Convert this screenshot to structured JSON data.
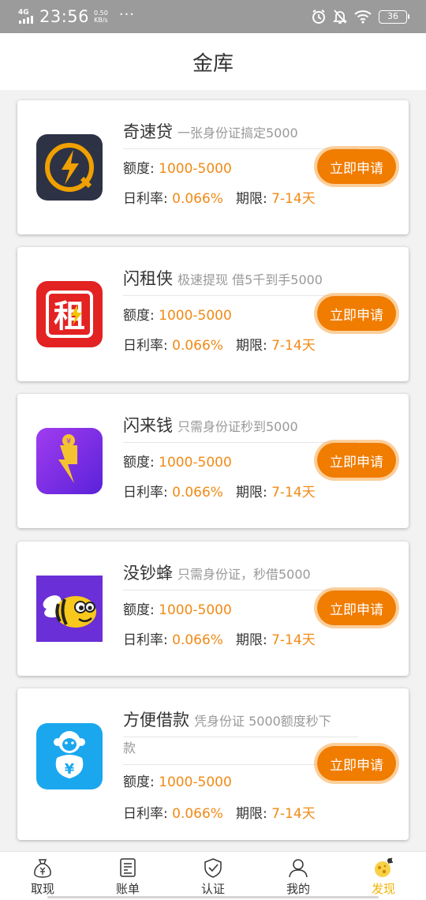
{
  "status_bar": {
    "network": "4G",
    "time": "23:56",
    "speed_value": "0.50",
    "speed_unit": "KB/s",
    "dots": "···",
    "battery": "36"
  },
  "header": {
    "title": "金库"
  },
  "labels": {
    "quota": "额度:",
    "rate": "日利率:",
    "term": "期限:",
    "apply": "立即申请"
  },
  "loans": [
    {
      "name": "奇速贷",
      "slogan": "一张身份证搞定5000",
      "quota": "1000-5000",
      "rate": "0.066%",
      "term": "7-14天"
    },
    {
      "name": "闪租侠",
      "slogan": "极速提现 借5千到手5000",
      "quota": "1000-5000",
      "rate": "0.066%",
      "term": "7-14天"
    },
    {
      "name": "闪来钱",
      "slogan": "只需身份证秒到5000",
      "quota": "1000-5000",
      "rate": "0.066%",
      "term": "7-14天"
    },
    {
      "name": "没钞蜂",
      "slogan": "只需身份证，秒借5000",
      "quota": "1000-5000",
      "rate": "0.066%",
      "term": "7-14天"
    },
    {
      "name": "方便借款",
      "slogan_a": "凭身份证 5000额度秒下",
      "slogan_b": "款",
      "quota": "1000-5000",
      "rate": "0.066%",
      "term": "7-14天"
    }
  ],
  "logo_text": {
    "zu": "租",
    "yen": "¥"
  },
  "tabs": [
    {
      "label": "取现",
      "icon": "money-bag-icon"
    },
    {
      "label": "账单",
      "icon": "bill-icon"
    },
    {
      "label": "认证",
      "icon": "shield-check-icon"
    },
    {
      "label": "我的",
      "icon": "user-icon"
    },
    {
      "label": "发现",
      "icon": "discover-icon"
    }
  ],
  "colors": {
    "accent": "#f07c00",
    "value": "#f08a16",
    "active_tab": "#f0b400"
  }
}
